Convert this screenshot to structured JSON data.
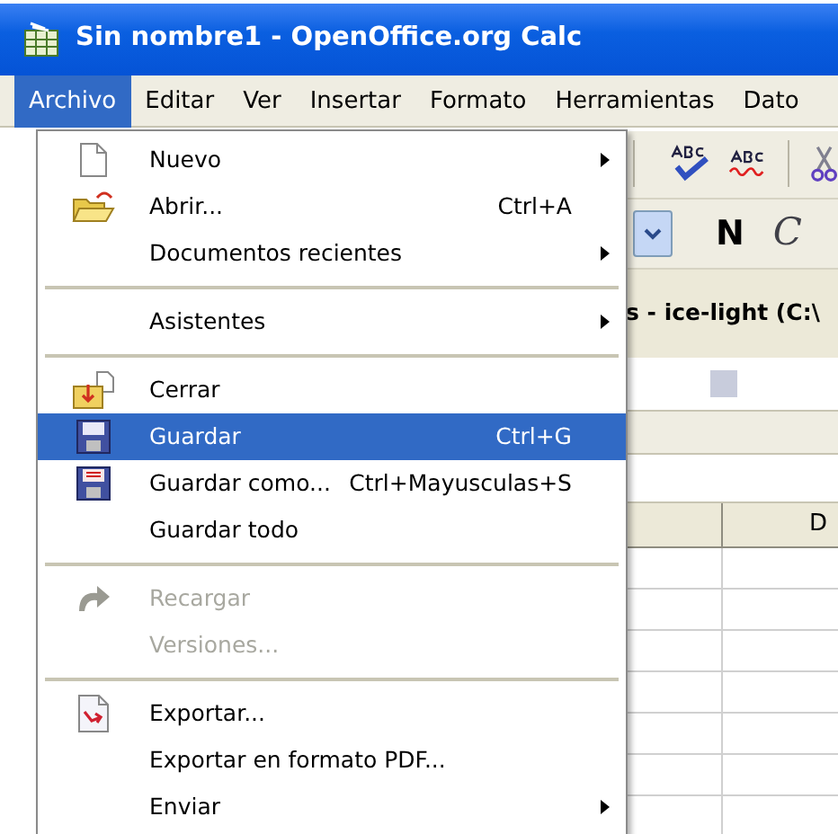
{
  "window": {
    "title": "Sin nombre1 - OpenOffice.org Calc"
  },
  "menubar": [
    {
      "label": "Archivo",
      "selected": true
    },
    {
      "label": "Editar",
      "selected": false
    },
    {
      "label": "Ver",
      "selected": false
    },
    {
      "label": "Insertar",
      "selected": false
    },
    {
      "label": "Formato",
      "selected": false
    },
    {
      "label": "Herramientas",
      "selected": false
    },
    {
      "label": "Dato",
      "selected": false
    }
  ],
  "file_menu": [
    {
      "kind": "item",
      "label": "Nuevo",
      "submenu": true,
      "selected": false,
      "disabled": false
    },
    {
      "kind": "item",
      "label": "Abrir...",
      "shortcut": "Ctrl+A",
      "submenu": false,
      "selected": false,
      "disabled": false
    },
    {
      "kind": "item",
      "label": "Documentos recientes",
      "submenu": true,
      "selected": false,
      "disabled": false
    },
    {
      "kind": "separator"
    },
    {
      "kind": "item",
      "label": "Asistentes",
      "submenu": true,
      "selected": false,
      "disabled": false
    },
    {
      "kind": "separator"
    },
    {
      "kind": "item",
      "label": "Cerrar",
      "submenu": false,
      "selected": false,
      "disabled": false
    },
    {
      "kind": "item",
      "label": "Guardar",
      "shortcut": "Ctrl+G",
      "submenu": false,
      "selected": true,
      "disabled": false
    },
    {
      "kind": "item",
      "label": "Guardar como...",
      "shortcut": "Ctrl+Mayusculas+S",
      "submenu": false,
      "selected": false,
      "disabled": false
    },
    {
      "kind": "item",
      "label": "Guardar todo",
      "submenu": false,
      "selected": false,
      "disabled": false
    },
    {
      "kind": "separator"
    },
    {
      "kind": "item",
      "label": "Recargar",
      "submenu": false,
      "selected": false,
      "disabled": true
    },
    {
      "kind": "item",
      "label": "Versiones...",
      "submenu": false,
      "selected": false,
      "disabled": true
    },
    {
      "kind": "separator"
    },
    {
      "kind": "item",
      "label": "Exportar...",
      "submenu": false,
      "selected": false,
      "disabled": false
    },
    {
      "kind": "item",
      "label": "Exportar en formato PDF...",
      "submenu": false,
      "selected": false,
      "disabled": false
    },
    {
      "kind": "item",
      "label": "Enviar",
      "submenu": true,
      "selected": false,
      "disabled": false
    }
  ],
  "format_toolbar": {
    "bold": "N",
    "italic": "C"
  },
  "document_bar": {
    "title": "s - ice-light (C:\\"
  },
  "sheet": {
    "column_header": "D"
  }
}
